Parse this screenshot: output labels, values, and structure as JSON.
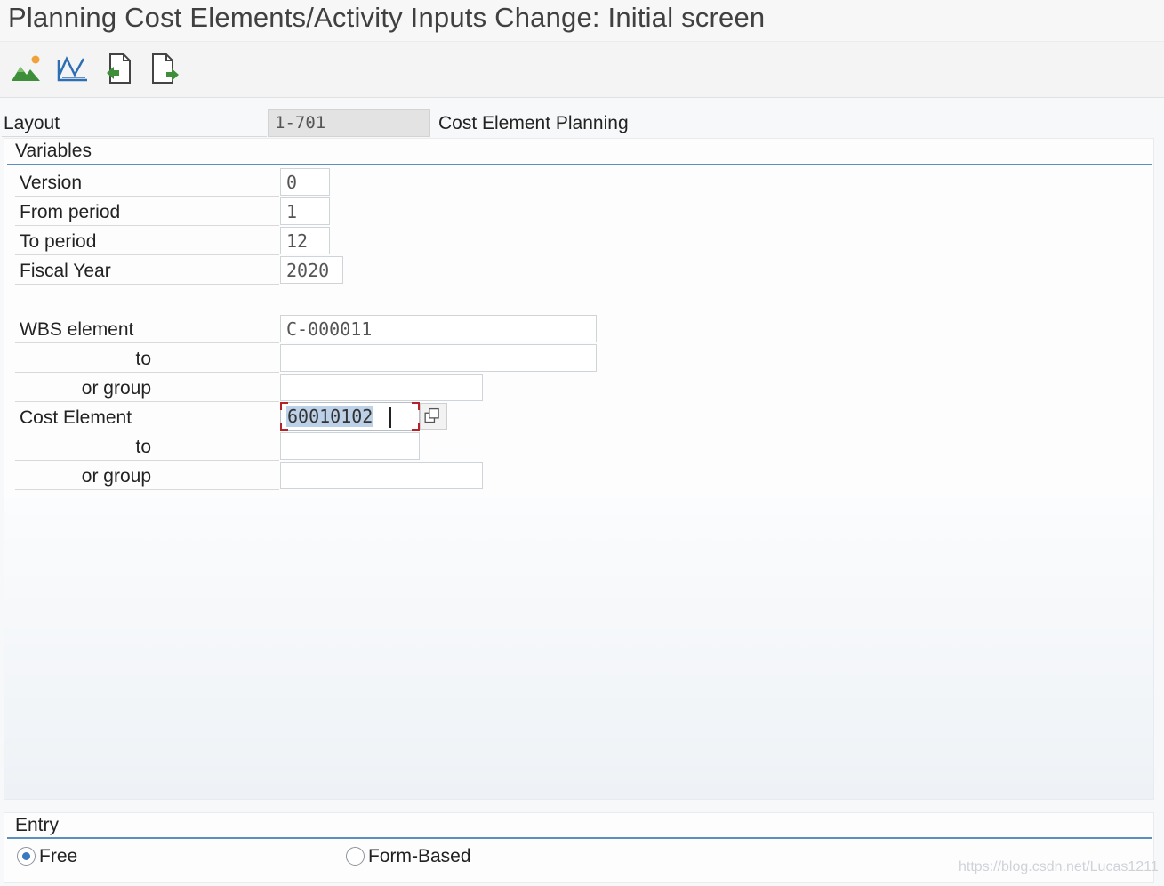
{
  "window": {
    "title": "Planning Cost Elements/Activity Inputs Change: Initial screen"
  },
  "toolbar": {
    "buttons": [
      {
        "icon": "mountain-icon"
      },
      {
        "icon": "chart-line-icon"
      },
      {
        "icon": "document-back-icon"
      },
      {
        "icon": "document-forward-icon"
      }
    ]
  },
  "layout": {
    "label": "Layout",
    "value": "1-701",
    "description": "Cost Element Planning"
  },
  "variables": {
    "title": "Variables",
    "version": {
      "label": "Version",
      "value": "0"
    },
    "from_period": {
      "label": "From period",
      "value": "1"
    },
    "to_period": {
      "label": "To period",
      "value": "12"
    },
    "fiscal_year": {
      "label": "Fiscal Year",
      "value": "2020"
    },
    "wbs_element": {
      "label": "WBS element",
      "value": "C-000011"
    },
    "wbs_to": {
      "label": "to",
      "value": ""
    },
    "wbs_group": {
      "label": "or group",
      "value": ""
    },
    "cost_element": {
      "label": "Cost Element",
      "value": "60010102"
    },
    "cost_to": {
      "label": "to",
      "value": ""
    },
    "cost_group": {
      "label": "or group",
      "value": ""
    }
  },
  "entry": {
    "title": "Entry",
    "options": [
      {
        "label": "Free",
        "selected": true
      },
      {
        "label": "Form-Based",
        "selected": false
      }
    ]
  },
  "watermark": "https://blog.csdn.net/Lucas1211"
}
